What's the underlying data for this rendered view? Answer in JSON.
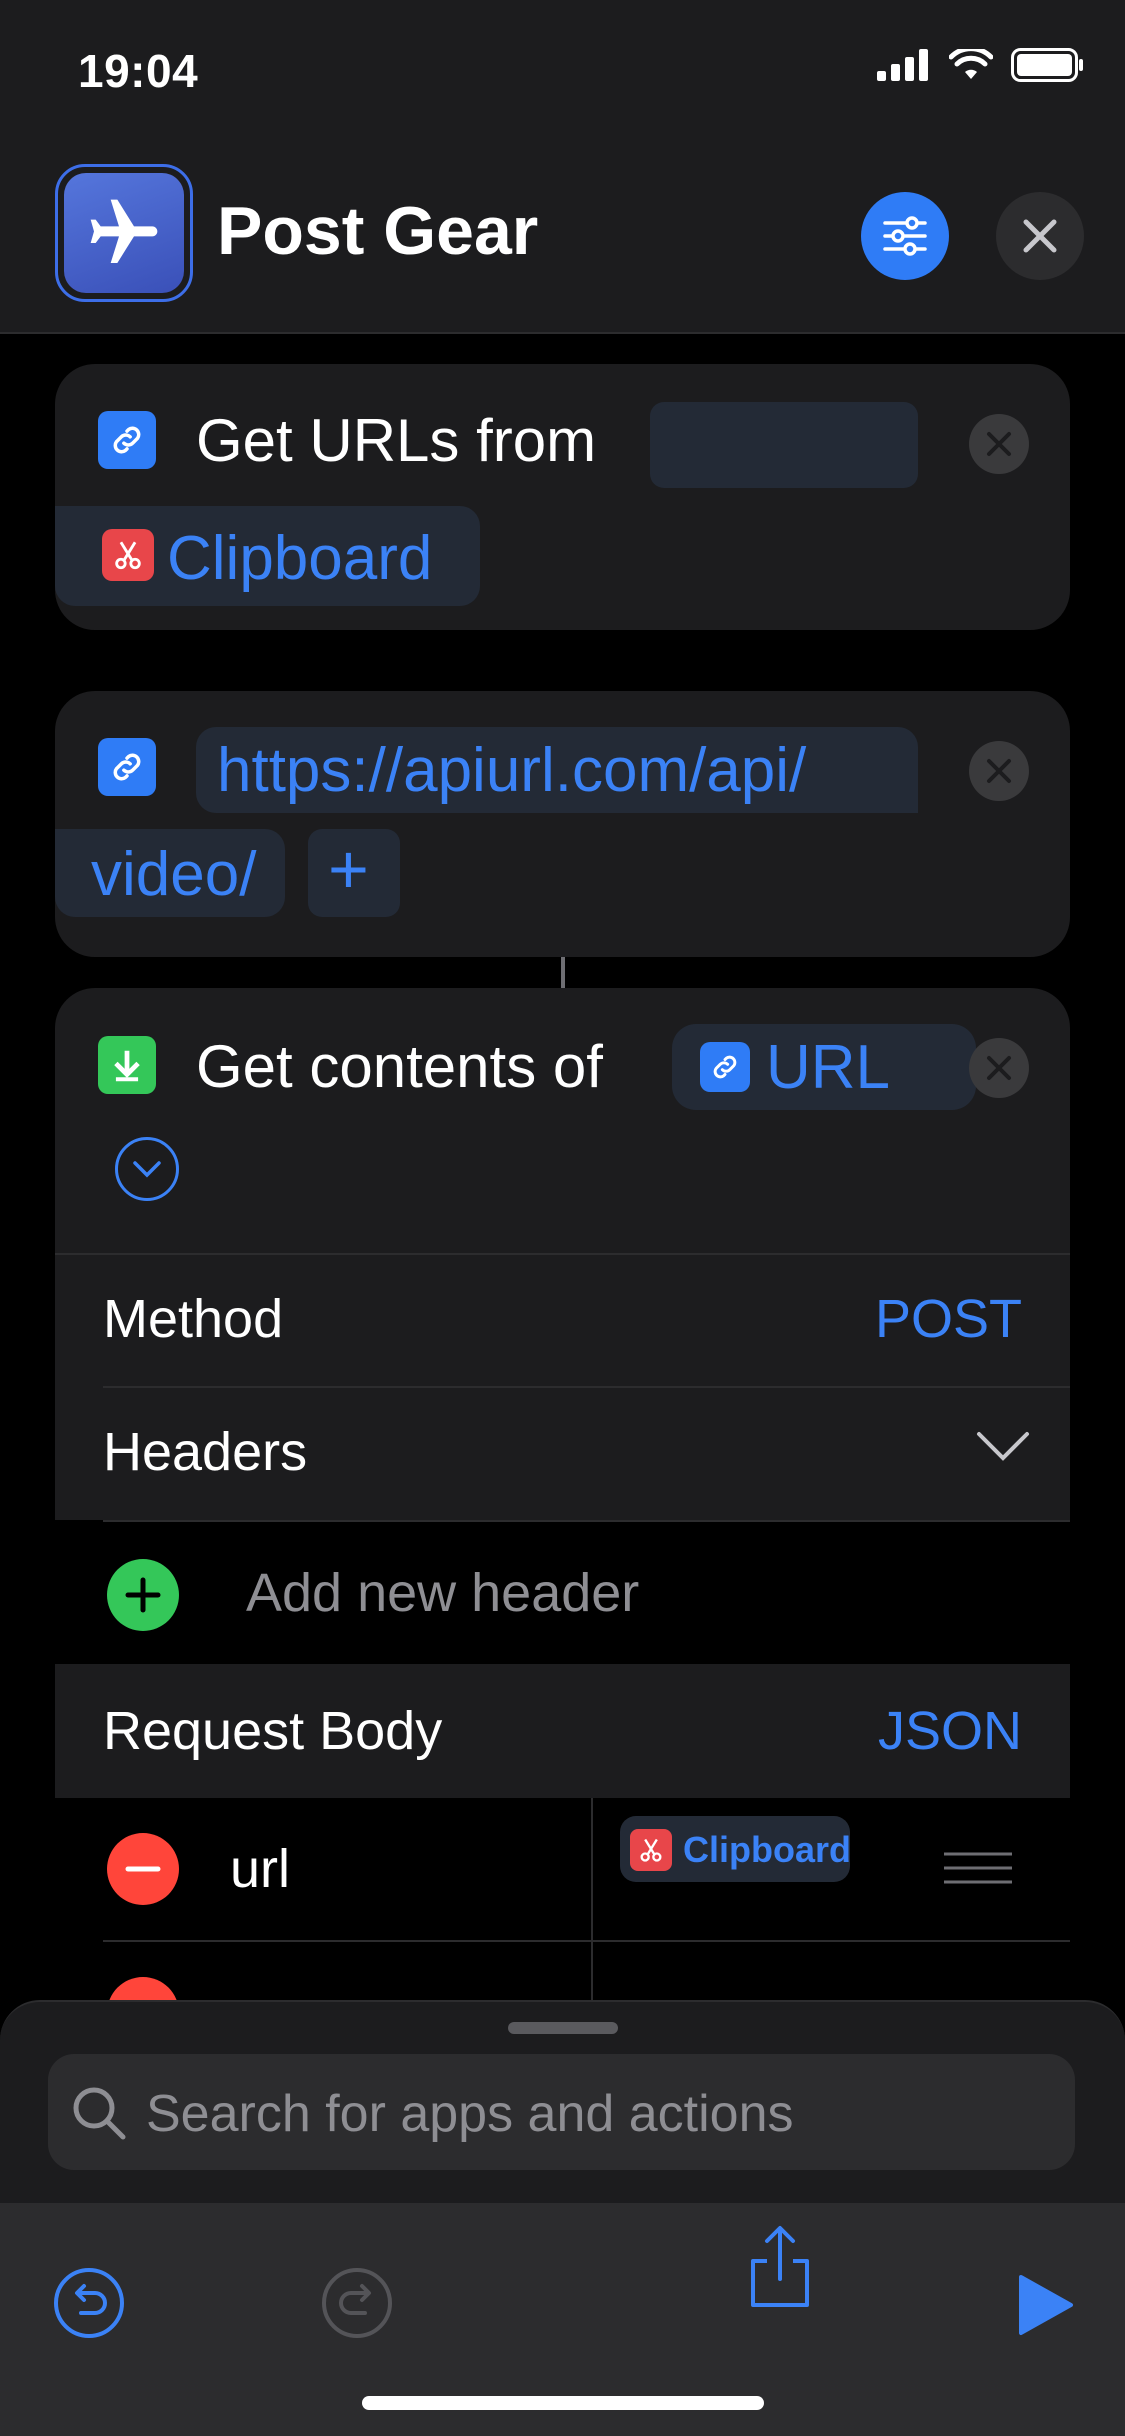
{
  "status_bar": {
    "time": "19:04"
  },
  "header": {
    "title": "Post Gear",
    "app_icon": "airplane-icon"
  },
  "card_get_urls": {
    "label": "Get URLs from",
    "source": "Clipboard",
    "action_icon": "link-icon",
    "source_icon": "scissors-icon"
  },
  "card_url": {
    "url_line1": "https://apiurl.com/api/",
    "url_line2": "video/",
    "add_symbol": "+"
  },
  "card_contents": {
    "label": "Get contents of",
    "variable": "URL",
    "method_label": "Method",
    "method_value": "POST",
    "headers_label": "Headers",
    "add_header_label": "Add new header",
    "request_body_label": "Request Body",
    "request_body_value": "JSON",
    "body_rows": [
      {
        "key": "url",
        "value": "Clipboard"
      }
    ]
  },
  "search": {
    "placeholder": "Search for apps and actions"
  },
  "colors": {
    "accent": "#2f7cf6",
    "link_blue": "#3b82f6",
    "add_green": "#34c759",
    "remove_red": "#ff453a",
    "clipboard_red": "#e8464a"
  }
}
